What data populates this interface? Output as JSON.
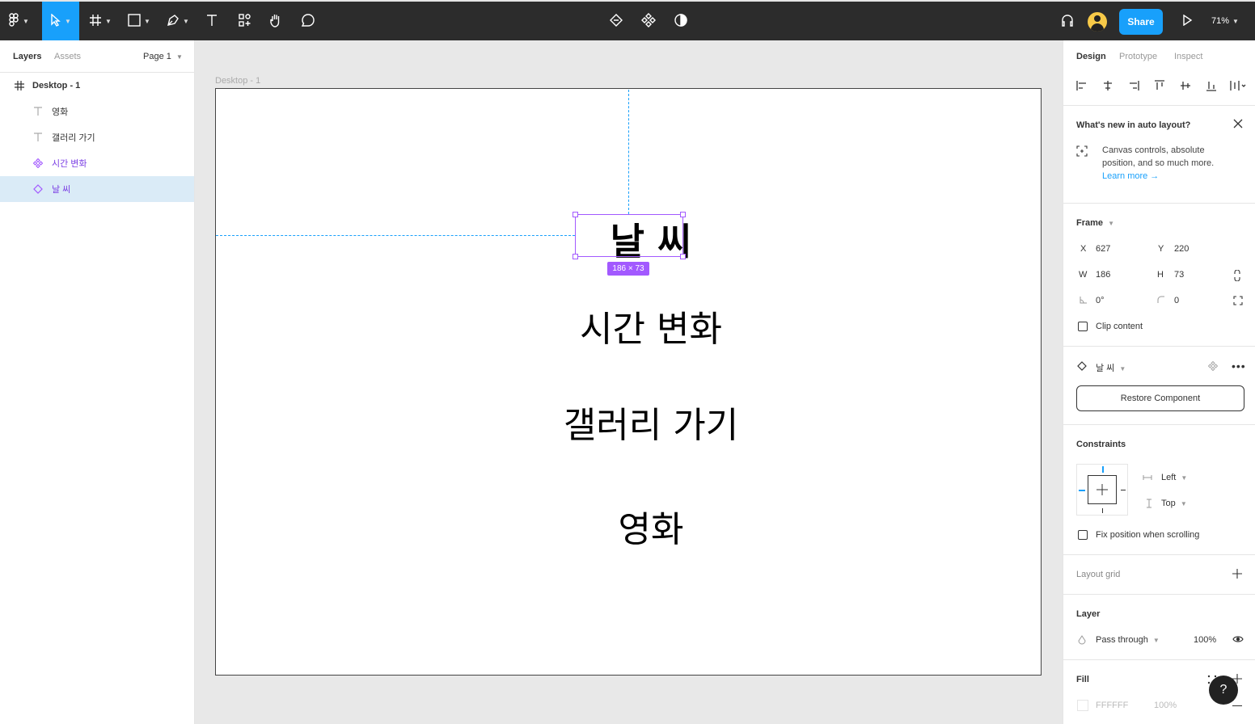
{
  "toolbar": {
    "share_label": "Share",
    "zoom": "71%",
    "tools": [
      {
        "name": "main-menu",
        "icon": "figma-logo-icon"
      },
      {
        "name": "move-tool",
        "icon": "pointer-icon",
        "active": true
      },
      {
        "name": "frame-tool",
        "icon": "hash-icon"
      },
      {
        "name": "shape-tool",
        "icon": "rectangle-icon"
      },
      {
        "name": "pen-tool",
        "icon": "pen-icon"
      },
      {
        "name": "text-tool",
        "icon": "text-icon"
      },
      {
        "name": "resources-tool",
        "icon": "resources-icon"
      },
      {
        "name": "hand-tool",
        "icon": "hand-icon"
      },
      {
        "name": "comment-tool",
        "icon": "comment-icon"
      }
    ]
  },
  "left_panel": {
    "tabs": [
      "Layers",
      "Assets"
    ],
    "page": "Page 1",
    "layers": [
      {
        "label": "Desktop - 1",
        "icon": "frame-icon",
        "kind": "frame"
      },
      {
        "label": "영화",
        "icon": "text-layer-icon",
        "kind": "text"
      },
      {
        "label": "갤러리 가기",
        "icon": "text-layer-icon",
        "kind": "text"
      },
      {
        "label": "시간 변화",
        "icon": "component-icon",
        "kind": "component"
      },
      {
        "label": "날 씨",
        "icon": "instance-icon",
        "kind": "instance",
        "selected": true
      }
    ]
  },
  "canvas": {
    "frame_label": "Desktop - 1",
    "texts": [
      "날 씨",
      "시간 변화",
      "갤러리 가기",
      "영화"
    ],
    "selection_size": "186 × 73"
  },
  "right_panel": {
    "tabs": [
      "Design",
      "Prototype",
      "Inspect"
    ],
    "autolayout_notice": {
      "title": "What's new in auto layout?",
      "body_line1": "Canvas controls, absolute",
      "body_line2": "position, and so much more.",
      "link": "Learn more →"
    },
    "frame": {
      "title": "Frame",
      "x_label": "X",
      "x": "627",
      "y_label": "Y",
      "y": "220",
      "w_label": "W",
      "w": "186",
      "h_label": "H",
      "h": "73",
      "rotation": "0°",
      "radius": "0",
      "clip_content": "Clip content"
    },
    "component": {
      "name": "날 씨",
      "restore_label": "Restore Component"
    },
    "constraints": {
      "title": "Constraints",
      "horizontal": "Left",
      "vertical": "Top",
      "fix_position": "Fix position when scrolling"
    },
    "layout_grid": "Layout grid",
    "layer": {
      "title": "Layer",
      "blend": "Pass through",
      "opacity": "100%"
    },
    "fill": {
      "title": "Fill",
      "hex": "FFFFFF",
      "opacity": "100%"
    }
  },
  "help_label": "?",
  "colors": {
    "accent": "#18a0fb",
    "selection": "#a259ff",
    "toolbar_bg": "#2c2c2c"
  }
}
